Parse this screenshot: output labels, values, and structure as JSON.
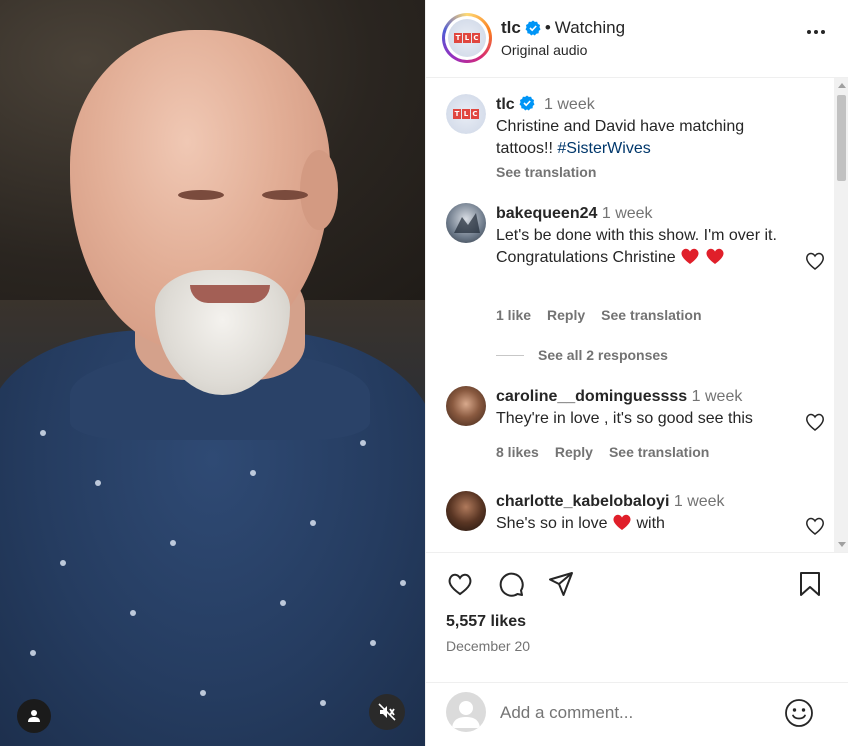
{
  "header": {
    "username": "tlc",
    "separator": "•",
    "status": "Watching",
    "subtitle": "Original audio"
  },
  "caption": {
    "username": "tlc",
    "time": "1 week",
    "text": "Christine and David have matching tattoos!! ",
    "hashtag": "#SisterWives",
    "see_translation": "See translation"
  },
  "comments": [
    {
      "username": "bakequeen24",
      "time": "1 week",
      "text": "Let's be done with this show. I'm over it. Congratulations Christine",
      "likes": "1 like",
      "reply": "Reply",
      "see_translation": "See translation"
    },
    {
      "username": "caroline__dominguessss",
      "time": "1 week",
      "text": "They're in love , it's so good see this",
      "likes": "8 likes",
      "reply": "Reply",
      "see_translation": "See translation"
    },
    {
      "username": "charlotte_kabelobaloyi",
      "time": "1 week",
      "text_before": "She's so in love ",
      "text_after": " with"
    }
  ],
  "responses_link": "See all 2 responses",
  "post": {
    "likes": "5,557 likes",
    "date": "December 20"
  },
  "add_comment": {
    "placeholder": "Add a comment..."
  },
  "colors": {
    "verified": "#0095f6",
    "heart_red": "#ed1c24",
    "hashtag": "#00376b",
    "muted_text": "#737373"
  }
}
